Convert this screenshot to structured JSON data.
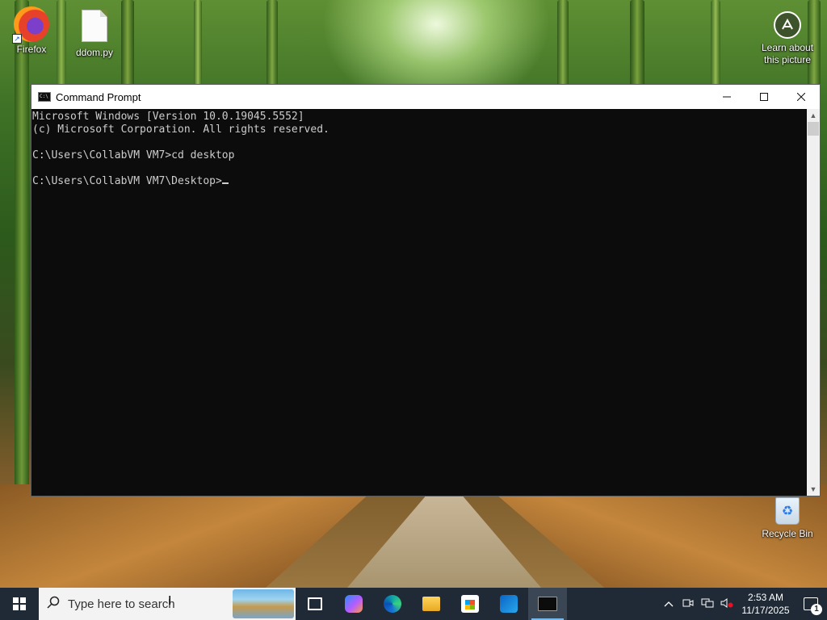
{
  "desktop": {
    "icons": [
      {
        "label": "Firefox",
        "icon": "firefox-icon"
      },
      {
        "label": "ddom.py",
        "icon": "python-file-icon"
      },
      {
        "label": "Learn about\nthis picture",
        "icon": "camera-icon"
      },
      {
        "label": "Recycle Bin",
        "icon": "recycle-bin-icon"
      }
    ]
  },
  "window": {
    "title": "Command Prompt",
    "controls": {
      "minimize": "—",
      "maximize": "☐",
      "close": "✕"
    },
    "console_lines": [
      "Microsoft Windows [Version 10.0.19045.5552]",
      "(c) Microsoft Corporation. All rights reserved.",
      "",
      "C:\\Users\\CollabVM VM7>cd desktop",
      "",
      "C:\\Users\\CollabVM VM7\\Desktop>"
    ]
  },
  "taskbar": {
    "search": {
      "placeholder": "Type here to search"
    },
    "apps": [
      "task-view-icon",
      "copilot-icon",
      "edge-icon",
      "file-explorer-icon",
      "store-icon",
      "outlook-icon",
      "command-prompt-icon"
    ],
    "active_app": "command-prompt-icon",
    "tray": {
      "time": "2:53 AM",
      "date": "11/17/2025",
      "notification_count": "1"
    }
  },
  "colors": {
    "console_bg": "#0c0c0c",
    "console_fg": "#cccccc",
    "taskbar_bg": "#1f2a36",
    "accent": "#76b9ed"
  }
}
